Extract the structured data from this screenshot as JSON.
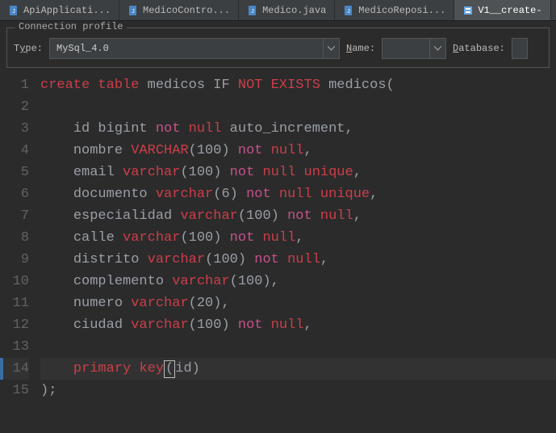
{
  "tabs": [
    {
      "label": "ApiApplicati..."
    },
    {
      "label": "MedicoContro..."
    },
    {
      "label": "Medico.java"
    },
    {
      "label": "MedicoReposi..."
    },
    {
      "label": "V1__create-",
      "active": true
    }
  ],
  "connection": {
    "legend": "Connection profile",
    "type_label_pre": "T",
    "type_label_accel": "y",
    "type_label_post": "pe:",
    "type_value": "MySql_4.0",
    "name_label_accel": "N",
    "name_label_post": "ame:",
    "name_value": "",
    "db_label_accel": "D",
    "db_label_post": "atabase:",
    "db_value": ""
  },
  "code": {
    "lines": [
      {
        "n": 1,
        "segments": [
          {
            "t": "create",
            "c": "kw-red"
          },
          {
            "t": " "
          },
          {
            "t": "table",
            "c": "kw-red"
          },
          {
            "t": " "
          },
          {
            "t": "medicos",
            "c": "ident"
          },
          {
            "t": " "
          },
          {
            "t": "IF",
            "c": "ident"
          },
          {
            "t": " "
          },
          {
            "t": "NOT",
            "c": "kw-red"
          },
          {
            "t": " "
          },
          {
            "t": "EXISTS",
            "c": "kw-red"
          },
          {
            "t": " "
          },
          {
            "t": "medicos",
            "c": "ident"
          },
          {
            "t": "(",
            "c": "ident"
          }
        ]
      },
      {
        "n": 2,
        "segments": []
      },
      {
        "n": 3,
        "segments": [
          {
            "t": "    "
          },
          {
            "t": "id",
            "c": "ident"
          },
          {
            "t": " "
          },
          {
            "t": "bigint",
            "c": "ident"
          },
          {
            "t": " "
          },
          {
            "t": "not",
            "c": "kw-pink"
          },
          {
            "t": " "
          },
          {
            "t": "null",
            "c": "kw-red"
          },
          {
            "t": " "
          },
          {
            "t": "auto_increment",
            "c": "ident"
          },
          {
            "t": ",",
            "c": "ident"
          }
        ]
      },
      {
        "n": 4,
        "segments": [
          {
            "t": "    "
          },
          {
            "t": "nombre",
            "c": "ident"
          },
          {
            "t": " "
          },
          {
            "t": "VARCHAR",
            "c": "kw-red"
          },
          {
            "t": "(100)",
            "c": "ident"
          },
          {
            "t": " "
          },
          {
            "t": "not",
            "c": "kw-pink"
          },
          {
            "t": " "
          },
          {
            "t": "null",
            "c": "kw-red"
          },
          {
            "t": ",",
            "c": "ident"
          }
        ]
      },
      {
        "n": 5,
        "segments": [
          {
            "t": "    "
          },
          {
            "t": "email",
            "c": "ident"
          },
          {
            "t": " "
          },
          {
            "t": "varchar",
            "c": "kw-red"
          },
          {
            "t": "(100)",
            "c": "ident"
          },
          {
            "t": " "
          },
          {
            "t": "not",
            "c": "kw-pink"
          },
          {
            "t": " "
          },
          {
            "t": "null",
            "c": "kw-red"
          },
          {
            "t": " "
          },
          {
            "t": "unique",
            "c": "kw-red"
          },
          {
            "t": ",",
            "c": "ident"
          }
        ]
      },
      {
        "n": 6,
        "segments": [
          {
            "t": "    "
          },
          {
            "t": "documento",
            "c": "ident"
          },
          {
            "t": " "
          },
          {
            "t": "varchar",
            "c": "kw-red"
          },
          {
            "t": "(6)",
            "c": "ident"
          },
          {
            "t": " "
          },
          {
            "t": "not",
            "c": "kw-pink"
          },
          {
            "t": " "
          },
          {
            "t": "null",
            "c": "kw-red"
          },
          {
            "t": " "
          },
          {
            "t": "unique",
            "c": "kw-red"
          },
          {
            "t": ",",
            "c": "ident"
          }
        ]
      },
      {
        "n": 7,
        "segments": [
          {
            "t": "    "
          },
          {
            "t": "especialidad",
            "c": "ident"
          },
          {
            "t": " "
          },
          {
            "t": "varchar",
            "c": "kw-red"
          },
          {
            "t": "(100)",
            "c": "ident"
          },
          {
            "t": " "
          },
          {
            "t": "not",
            "c": "kw-pink"
          },
          {
            "t": " "
          },
          {
            "t": "null",
            "c": "kw-red"
          },
          {
            "t": ",",
            "c": "ident"
          }
        ]
      },
      {
        "n": 8,
        "segments": [
          {
            "t": "    "
          },
          {
            "t": "calle",
            "c": "ident"
          },
          {
            "t": " "
          },
          {
            "t": "varchar",
            "c": "kw-red"
          },
          {
            "t": "(100)",
            "c": "ident"
          },
          {
            "t": " "
          },
          {
            "t": "not",
            "c": "kw-pink"
          },
          {
            "t": " "
          },
          {
            "t": "null",
            "c": "kw-red"
          },
          {
            "t": ",",
            "c": "ident"
          }
        ]
      },
      {
        "n": 9,
        "segments": [
          {
            "t": "    "
          },
          {
            "t": "distrito",
            "c": "ident"
          },
          {
            "t": " "
          },
          {
            "t": "varchar",
            "c": "kw-red"
          },
          {
            "t": "(100)",
            "c": "ident"
          },
          {
            "t": " "
          },
          {
            "t": "not",
            "c": "kw-pink"
          },
          {
            "t": " "
          },
          {
            "t": "null",
            "c": "kw-red"
          },
          {
            "t": ",",
            "c": "ident"
          }
        ]
      },
      {
        "n": 10,
        "segments": [
          {
            "t": "    "
          },
          {
            "t": "complemento",
            "c": "ident"
          },
          {
            "t": " "
          },
          {
            "t": "varchar",
            "c": "kw-red"
          },
          {
            "t": "(100)",
            "c": "ident"
          },
          {
            "t": ",",
            "c": "ident"
          }
        ]
      },
      {
        "n": 11,
        "segments": [
          {
            "t": "    "
          },
          {
            "t": "numero",
            "c": "ident"
          },
          {
            "t": " "
          },
          {
            "t": "varchar",
            "c": "kw-red"
          },
          {
            "t": "(20)",
            "c": "ident"
          },
          {
            "t": ",",
            "c": "ident"
          }
        ]
      },
      {
        "n": 12,
        "segments": [
          {
            "t": "    "
          },
          {
            "t": "ciudad",
            "c": "ident"
          },
          {
            "t": " "
          },
          {
            "t": "varchar",
            "c": "kw-red"
          },
          {
            "t": "(100)",
            "c": "ident"
          },
          {
            "t": " "
          },
          {
            "t": "not",
            "c": "kw-pink"
          },
          {
            "t": " "
          },
          {
            "t": "null",
            "c": "kw-red"
          },
          {
            "t": ",",
            "c": "ident"
          }
        ]
      },
      {
        "n": 13,
        "segments": []
      },
      {
        "n": 14,
        "current": true,
        "segments": [
          {
            "t": "    "
          },
          {
            "t": "primary",
            "c": "kw-red"
          },
          {
            "t": " "
          },
          {
            "t": "key",
            "c": "kw-red"
          },
          {
            "t": "(",
            "c": "ident",
            "caret": true
          },
          {
            "t": "id)",
            "c": "ident"
          }
        ]
      },
      {
        "n": 15,
        "segments": [
          {
            "t": ");",
            "c": "ident"
          }
        ]
      }
    ]
  }
}
